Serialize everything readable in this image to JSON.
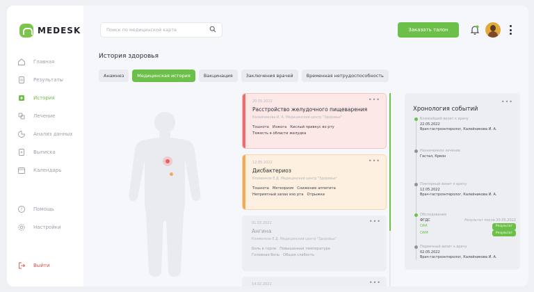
{
  "app": {
    "name": "MEDESK"
  },
  "colors": {
    "accent": "#6cc04a",
    "danger": "#ef6b6b",
    "warning": "#f4aa55",
    "logout": "#e5514b"
  },
  "sidebar": {
    "items": [
      {
        "label": "Главная",
        "icon": "home-icon"
      },
      {
        "label": "Результаты",
        "icon": "document-icon"
      },
      {
        "label": "История",
        "icon": "history-icon",
        "active": true
      },
      {
        "label": "Лечение",
        "icon": "treatment-icon"
      },
      {
        "label": "Анализ данных",
        "icon": "chart-icon"
      },
      {
        "label": "Выписка",
        "icon": "discharge-icon"
      },
      {
        "label": "Календарь",
        "icon": "calendar-icon"
      }
    ],
    "bottom": [
      {
        "label": "Помощь",
        "icon": "help-icon"
      },
      {
        "label": "Настройки",
        "icon": "settings-icon"
      }
    ],
    "logout": "Выйти"
  },
  "header": {
    "search_placeholder": "Поиск по медицинской карте",
    "ticket_button": "Заказать талон"
  },
  "page": {
    "title": "История здоровья",
    "tabs": [
      "Анамнез",
      "Медицинская история",
      "Вакцинация",
      "Заключения врачей",
      "Временная нетрудоспособность"
    ],
    "active_tab": "Медицинская история"
  },
  "cards": [
    {
      "date": "20.05.2022",
      "title": "Расстройство желудочного пищеварения",
      "doctor": "Калейникова И. А.     Медицинский центр \"Здоровье\"",
      "symptoms_line1": [
        "Тошнота",
        "Изжога",
        "Кислый привкус во рту"
      ],
      "symptoms_line2": [
        "Тяжесть в области желудка"
      ]
    },
    {
      "date": "12.05.2022",
      "title": "Дисбактериоз",
      "doctor": "Клименков Е.Д.     Медицинский центр \"Здоровье\"",
      "symptoms_line1": [
        "Тошнота",
        "Метеоризм",
        "Снижение аппетита"
      ],
      "symptoms_line2": [
        "Неприятный запах изо рта",
        "Отрыжка"
      ]
    },
    {
      "date": "01.03.2022",
      "title": "Ангина",
      "doctor": "Клименков Е.Д.     Медицинский центр \"Здоровье\"",
      "symptoms_line1": [
        "Боль в горле",
        "Повышенная температура"
      ],
      "symptoms_line2": [
        "Головная боль",
        "Общая слабость"
      ]
    },
    {
      "date": "14.02.2022"
    }
  ],
  "timeline": {
    "title": "Хронология событий",
    "items": [
      {
        "label": "Ближайший визит к врачу",
        "date": "22.05.2022",
        "text": "Врач-гастроэнтеролог, Калейникова И. А.",
        "green": true
      },
      {
        "label": "Назначенное лечение",
        "text": "Гастал, Креон",
        "green": false
      },
      {
        "label": "Повторный визит к врачу",
        "date": "12.05.2022",
        "text": "Врач-гастроэнтеролог, Калейникова И. А.",
        "green": false
      },
      {
        "label": "Обследования",
        "green": true,
        "exams": [
          {
            "name": "ФГДС",
            "note": "Результат после 20.05.2022"
          },
          {
            "name": "ОАК",
            "badge": "Результат"
          },
          {
            "name": "ОАМ",
            "badge": "Результат"
          }
        ]
      },
      {
        "label": "Первичный визит к врачу",
        "date": "02.05.2022",
        "text": "Врач-гастроэнтеролог, Калейникова И. А.",
        "green": false
      }
    ]
  }
}
